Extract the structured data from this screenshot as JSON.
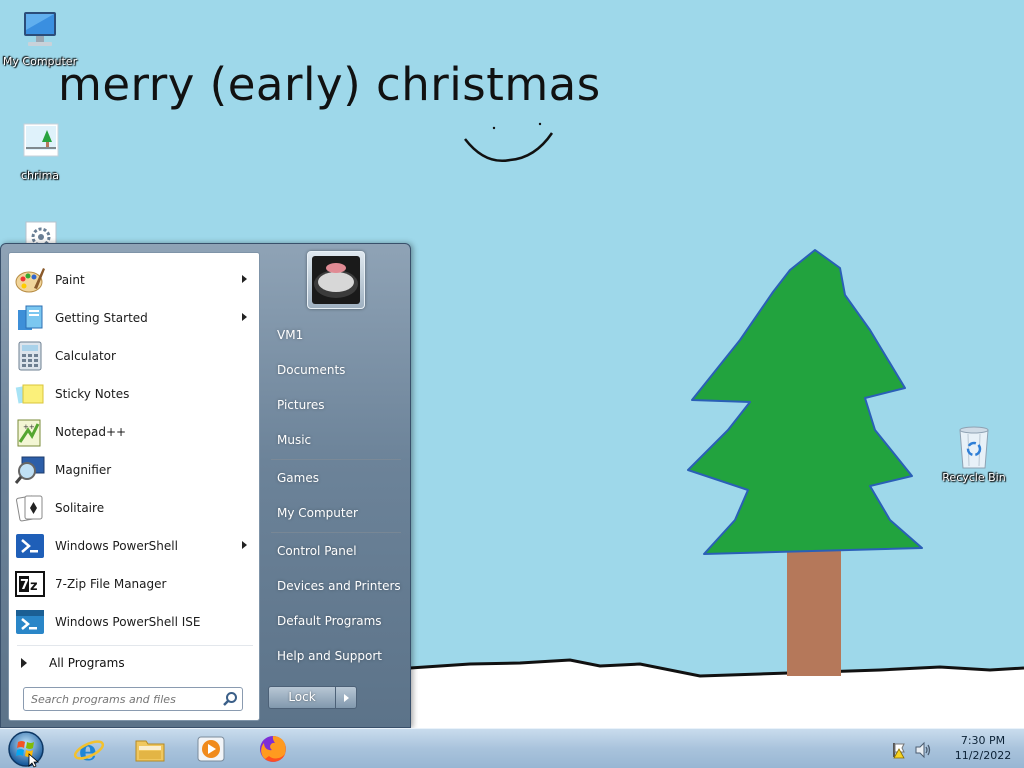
{
  "desktop": {
    "background_color": "#9ed8ea",
    "headline": "merry (early) christmas",
    "icons": [
      {
        "label": "My Computer",
        "icon": "computer-icon"
      },
      {
        "label": "chrima",
        "icon": "image-file-icon"
      },
      {
        "label": "",
        "icon": "settings-file-icon"
      },
      {
        "label": "Recycle Bin",
        "icon": "recycle-bin-icon"
      }
    ]
  },
  "start_menu": {
    "programs": [
      {
        "label": "Paint",
        "icon": "paint-icon",
        "submenu": true
      },
      {
        "label": "Getting Started",
        "icon": "getting-started-icon",
        "submenu": true
      },
      {
        "label": "Calculator",
        "icon": "calculator-icon",
        "submenu": false
      },
      {
        "label": "Sticky Notes",
        "icon": "sticky-notes-icon",
        "submenu": false
      },
      {
        "label": "Notepad++",
        "icon": "notepad-plus-plus-icon",
        "submenu": false
      },
      {
        "label": "Magnifier",
        "icon": "magnifier-icon",
        "submenu": false
      },
      {
        "label": "Solitaire",
        "icon": "solitaire-icon",
        "submenu": false
      },
      {
        "label": "Windows PowerShell",
        "icon": "powershell-icon",
        "submenu": true
      },
      {
        "label": "7-Zip File Manager",
        "icon": "7zip-icon",
        "submenu": false
      },
      {
        "label": "Windows PowerShell ISE",
        "icon": "powershell-ise-icon",
        "submenu": false
      }
    ],
    "all_programs_label": "All Programs",
    "search_placeholder": "Search programs and files",
    "right_links": [
      "VM1",
      "Documents",
      "Pictures",
      "Music",
      "Games",
      "My Computer",
      "Control Panel",
      "Devices and Printers",
      "Default Programs",
      "Help and Support"
    ],
    "lock_label": "Lock"
  },
  "taskbar": {
    "pinned": [
      {
        "name": "internet-explorer",
        "icon": "internet-explorer-icon"
      },
      {
        "name": "windows-explorer",
        "icon": "folder-icon"
      },
      {
        "name": "media-player",
        "icon": "media-player-icon"
      },
      {
        "name": "firefox",
        "icon": "firefox-icon"
      }
    ],
    "tray": {
      "time": "7:30 PM",
      "date": "11/2/2022"
    }
  }
}
